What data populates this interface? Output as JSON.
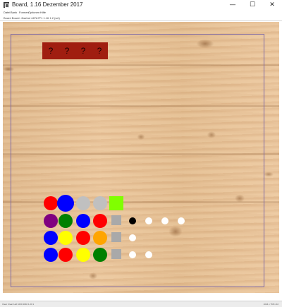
{
  "window": {
    "title": "Board, 1.16 Dezember 2017",
    "app_icon": "board-app-icon",
    "controls": {
      "minimize": "—",
      "maximize": "☐",
      "close": "✕"
    }
  },
  "menu": {
    "items": [
      "Datei",
      "Bank",
      "Formen",
      "Optionen",
      "Hilfe"
    ]
  },
  "info": {
    "text": "Board Board: Jbarbot 44FA7F1 1.16 1.2 (sel)"
  },
  "board": {
    "cards": [
      {
        "label": "?",
        "color": "#a01e10"
      },
      {
        "label": "?",
        "color": "#a01e10"
      },
      {
        "label": "?",
        "color": "#a01e10"
      },
      {
        "label": "?",
        "color": "#a01e10"
      }
    ],
    "guess_rows": [
      {
        "tokens": [
          {
            "kind": "circle",
            "color": "#ff0000"
          },
          {
            "kind": "circle",
            "color": "#0000ff"
          },
          {
            "kind": "circle",
            "color": "#c0c0c0"
          },
          {
            "kind": "circle",
            "color": "#c0c0c0"
          },
          {
            "kind": "square",
            "color": "#80ff00"
          }
        ],
        "pegs": []
      },
      {
        "tokens": [
          {
            "kind": "circle",
            "color": "#800080"
          },
          {
            "kind": "circle",
            "color": "#008000"
          },
          {
            "kind": "circle",
            "color": "#0000ff"
          },
          {
            "kind": "circle",
            "color": "#ff0000"
          },
          {
            "kind": "square",
            "color": "#a9a9a9"
          }
        ],
        "pegs": [
          "#000000",
          "#ffffff",
          "#ffffff",
          "#ffffff"
        ]
      },
      {
        "tokens": [
          {
            "kind": "circle",
            "color": "#0000ff"
          },
          {
            "kind": "circle",
            "color": "#ffff00"
          },
          {
            "kind": "circle",
            "color": "#ff0000"
          },
          {
            "kind": "circle",
            "color": "#ffa500"
          },
          {
            "kind": "square",
            "color": "#a9a9a9"
          }
        ],
        "pegs": [
          "#ffffff"
        ]
      },
      {
        "tokens": [
          {
            "kind": "circle",
            "color": "#0000ff"
          },
          {
            "kind": "circle",
            "color": "#ff0000"
          },
          {
            "kind": "circle",
            "color": "#ffff00"
          },
          {
            "kind": "circle",
            "color": "#008000"
          },
          {
            "kind": "square",
            "color": "#a9a9a9"
          }
        ],
        "pegs": [
          "#ffffff",
          "#ffffff"
        ]
      }
    ]
  },
  "status": {
    "left": "Clear   Clear 1a0 1000 4040 1.20 1",
    "right": "1024 x 768 x 32"
  }
}
